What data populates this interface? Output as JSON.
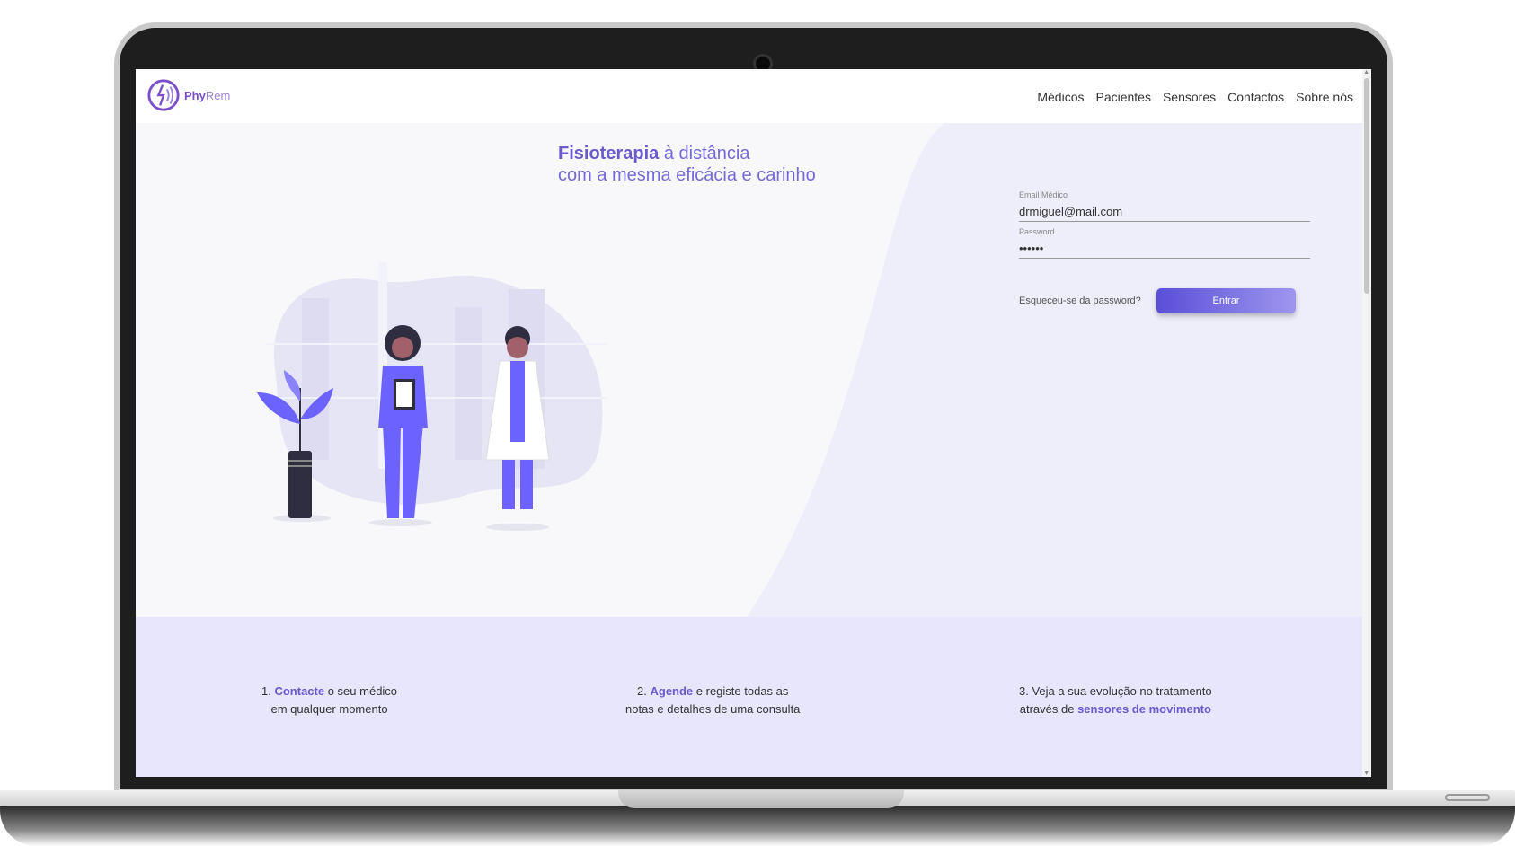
{
  "brand": {
    "name_bold": "Phy",
    "name_light": "Rem"
  },
  "nav": [
    "Médicos",
    "Pacientes",
    "Sensores",
    "Contactos",
    "Sobre nós"
  ],
  "hero": {
    "tagline_bold": "Fisioterapia",
    "tagline_rest": "à distância",
    "tagline_line2": "com a mesma eficácia e carinho"
  },
  "login": {
    "email_label": "Email Médico",
    "email_value": "drmiguel@mail.com",
    "password_label": "Password",
    "password_value": "••••••",
    "forgot": "Esqueceu-se da password?",
    "submit": "Entrar"
  },
  "steps": [
    {
      "num": "1.",
      "highlight": "Contacte",
      "rest": "o seu médico",
      "line2": "em qualquer momento"
    },
    {
      "num": "2.",
      "highlight": "Agende",
      "rest": "e registe todas as",
      "line2": "notas e detalhes de uma consulta"
    },
    {
      "line1": "3. Veja a sua evolução no tratamento",
      "pre": "através de",
      "highlight": "sensores de movimento"
    }
  ],
  "colors": {
    "accent": "#6a5acd",
    "hero_bg": "#eeedfa",
    "steps_bg": "#e8e6fc"
  }
}
